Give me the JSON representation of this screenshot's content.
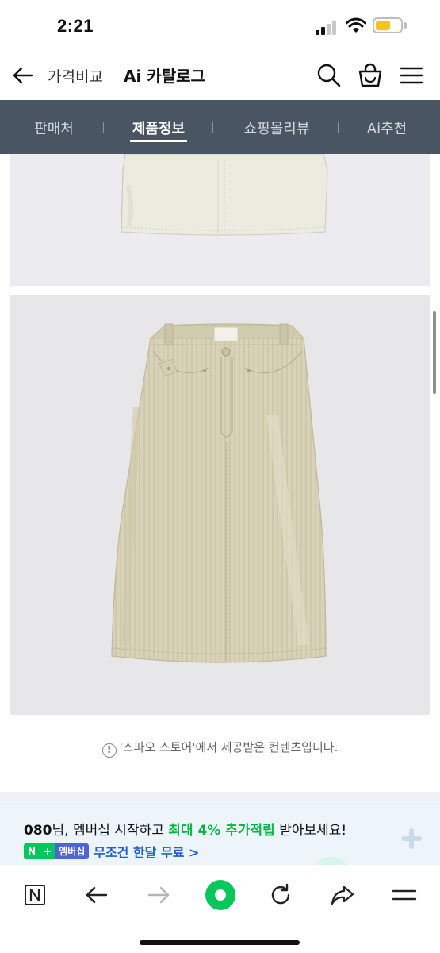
{
  "status_bar": {
    "time": "2:21"
  },
  "header": {
    "compare_label": "가격비교",
    "catalog_label": "Ai 카탈로그"
  },
  "tabs": [
    {
      "label": "판매처",
      "active": false
    },
    {
      "label": "제품정보",
      "active": true
    },
    {
      "label": "쇼핑몰리뷰",
      "active": false
    },
    {
      "label": "Ai추천",
      "active": false
    }
  ],
  "notice": {
    "icon": "!",
    "text": "'스파오 스토어'에서 제공받은 컨텐츠입니다."
  },
  "banner": {
    "line1_strong": "080",
    "line1_mid": "님, 멤버십 시작하고 ",
    "line1_highlight": "최대 4% 추가적립",
    "line1_end": " 받아보세요!",
    "badge_n": "N",
    "badge_plus": "+",
    "badge_membership": "멤버십",
    "free_text": "무조건 한달 무료 >"
  },
  "colors": {
    "tab_bar": "#4a5563",
    "accent_green": "#00b843",
    "link_blue": "#1f5fd0",
    "battery": "#f5c518"
  },
  "icons": {
    "back": "back-arrow-icon",
    "search": "search-icon",
    "cart": "shopping-bag-icon",
    "menu": "hamburger-menu-icon",
    "toolbar": [
      "naver-n-icon",
      "back-icon",
      "forward-icon",
      "green-dot-home-icon",
      "refresh-icon",
      "share-icon",
      "menu-icon"
    ]
  }
}
